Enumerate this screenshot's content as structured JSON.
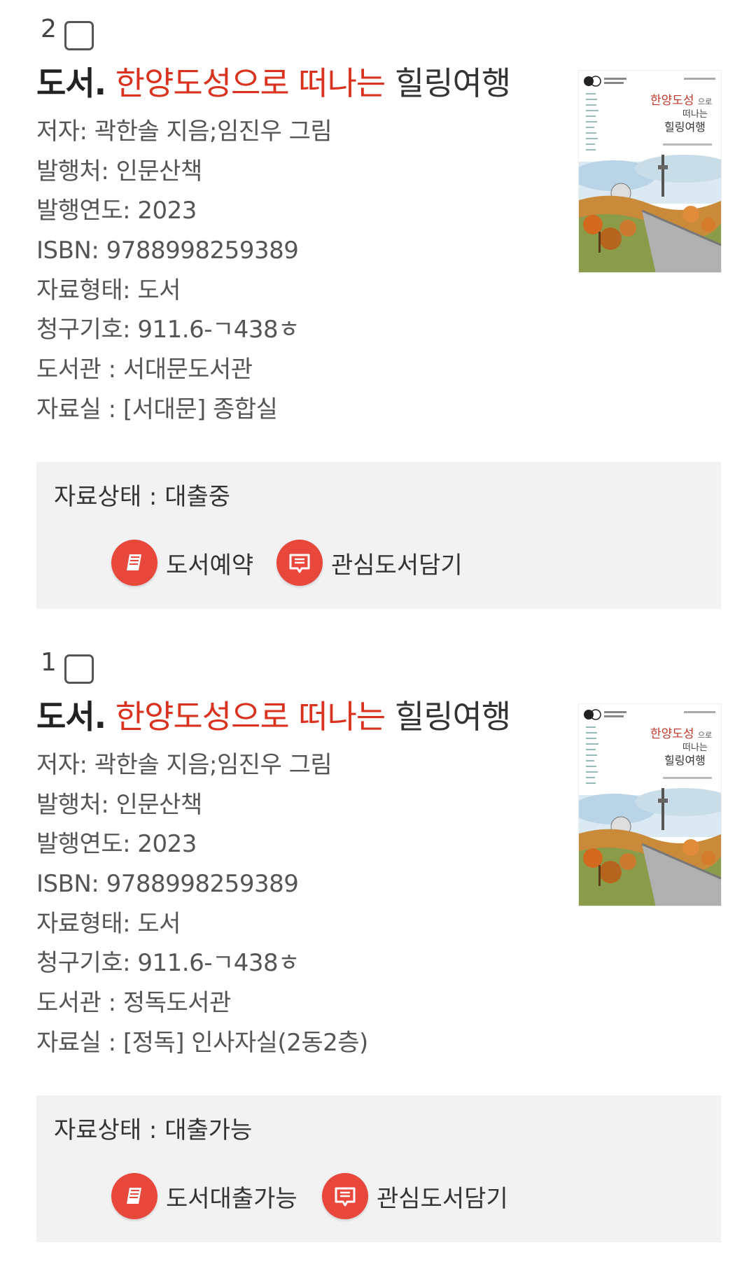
{
  "records": [
    {
      "index": "2",
      "title": {
        "kind": "도서.",
        "highlight": "한양도성으로 떠나는",
        "rest": "힐링여행"
      },
      "meta": [
        "저자: 곽한솔 지음;임진우 그림",
        "발행처: 인문산책",
        "발행연도: 2023",
        "ISBN: 9788998259389",
        "자료형태: 도서",
        "청구기호: 911.6-ㄱ438ㅎ",
        "도서관 : 서대문도서관",
        "자료실 : [서대문] 종합실"
      ],
      "cover": {
        "title_part1": "한양도성",
        "title_part1b": "으로",
        "title_part2": "떠나는",
        "title_part3": "힐링여행"
      },
      "status": "자료상태 : 대출중",
      "buttons": {
        "primary": "도서예약",
        "wish": "관심도서담기"
      }
    },
    {
      "index": "1",
      "title": {
        "kind": "도서.",
        "highlight": "한양도성으로 떠나는",
        "rest": "힐링여행"
      },
      "meta": [
        "저자: 곽한솔 지음;임진우 그림",
        "발행처: 인문산책",
        "발행연도: 2023",
        "ISBN: 9788998259389",
        "자료형태: 도서",
        "청구기호: 911.6-ㄱ438ㅎ",
        "도서관 : 정독도서관",
        "자료실 : [정독] 인사자실(2동2층)"
      ],
      "cover": {
        "title_part1": "한양도성",
        "title_part1b": "으로",
        "title_part2": "떠나는",
        "title_part3": "힐링여행"
      },
      "status": "자료상태 : 대출가능",
      "buttons": {
        "primary": "도서대출가능",
        "wish": "관심도서담기"
      }
    }
  ],
  "colors": {
    "highlight": "#d9331f",
    "icon_bg": "#e8473c",
    "status_bg": "#f2f2f2"
  },
  "icons": {
    "primary": "book-icon",
    "wish": "bookmark-list-icon"
  }
}
